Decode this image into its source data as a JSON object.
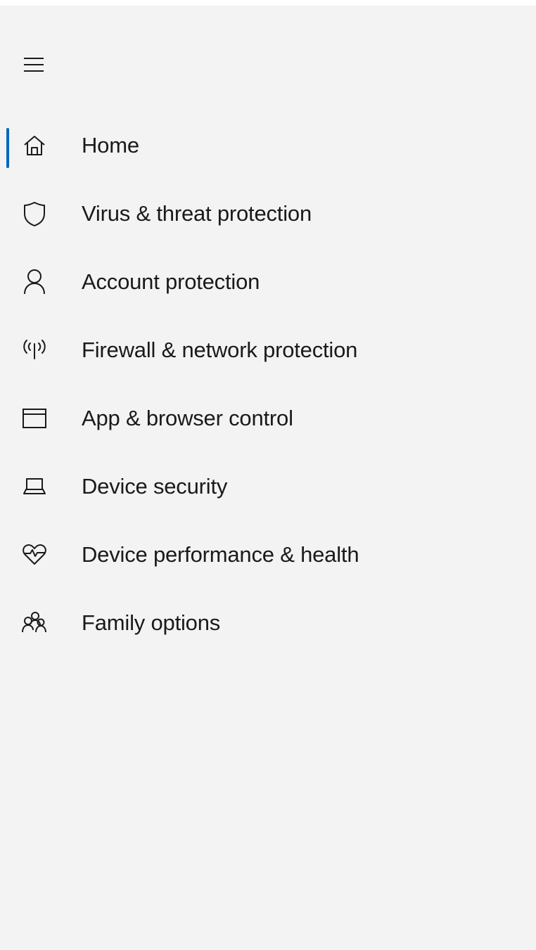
{
  "menu_button": {
    "icon": "hamburger-menu-icon"
  },
  "nav": {
    "selected_index": 0,
    "accent_color": "#0067c0",
    "items": [
      {
        "label": "Home",
        "icon": "home-icon"
      },
      {
        "label": "Virus & threat protection",
        "icon": "shield-icon"
      },
      {
        "label": "Account protection",
        "icon": "person-icon"
      },
      {
        "label": "Firewall & network protection",
        "icon": "wireless-antenna-icon"
      },
      {
        "label": "App & browser control",
        "icon": "app-window-icon"
      },
      {
        "label": "Device security",
        "icon": "laptop-icon"
      },
      {
        "label": "Device performance & health",
        "icon": "heart-pulse-icon"
      },
      {
        "label": "Family options",
        "icon": "family-icon"
      }
    ]
  }
}
